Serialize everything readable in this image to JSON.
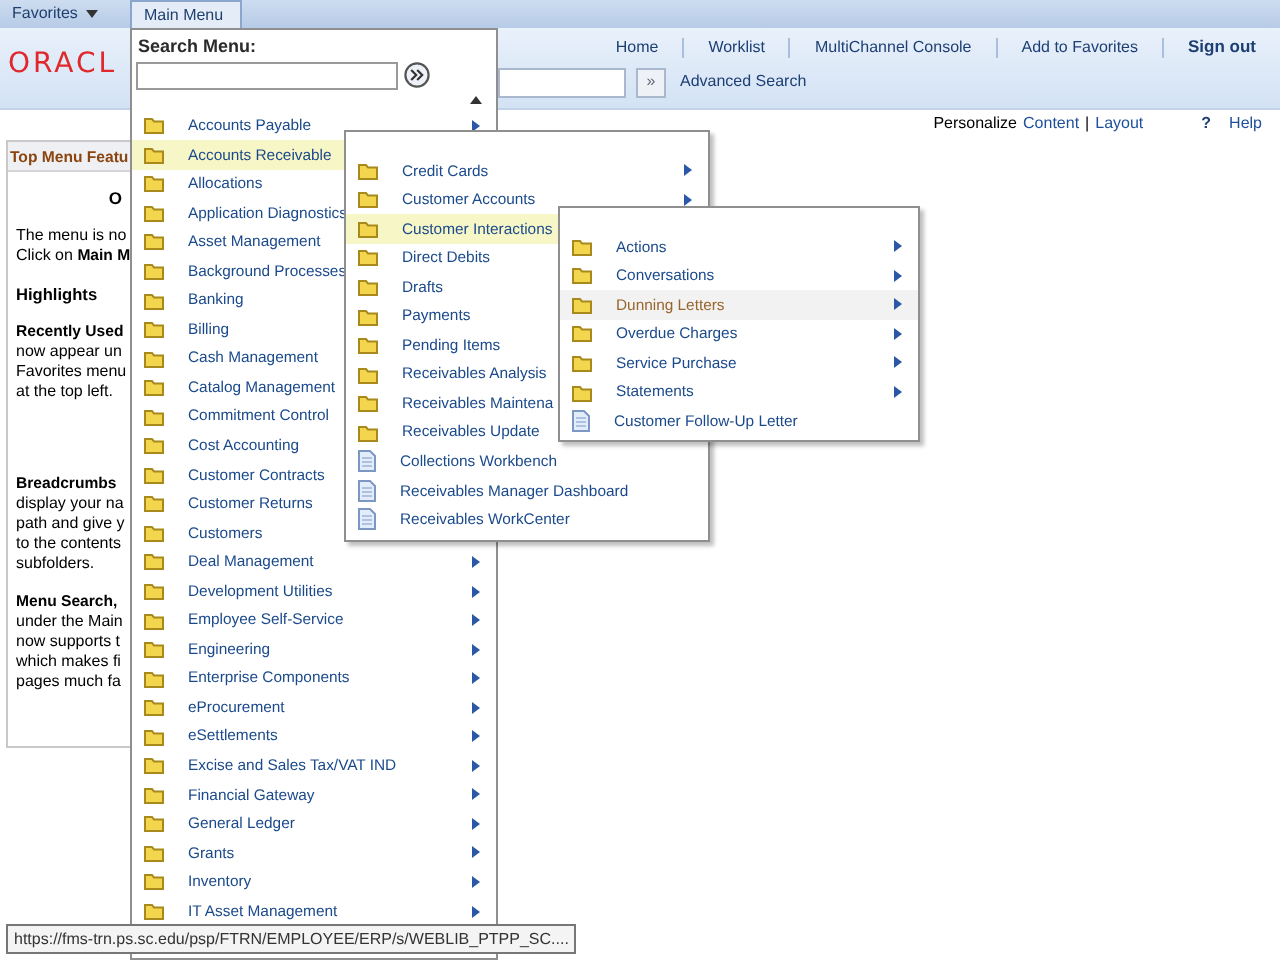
{
  "top_nav": [
    {
      "label": "Favorites",
      "selected": false
    },
    {
      "label": "Main Menu",
      "selected": true
    }
  ],
  "logo": "ORACL",
  "global_links": [
    {
      "label": "Home",
      "bold": false
    },
    {
      "label": "Worklist",
      "bold": false
    },
    {
      "label": "MultiChannel Console",
      "bold": false
    },
    {
      "label": "Add to Favorites",
      "bold": false
    },
    {
      "label": "Sign out",
      "bold": true
    }
  ],
  "search": {
    "button": "»",
    "link": "Advanced Search"
  },
  "personalize": {
    "label": "Personalize",
    "links": [
      "Content",
      "Layout"
    ],
    "separator": "|"
  },
  "help": {
    "icon": "?",
    "label": "Help"
  },
  "pagelet": {
    "title": "Top Menu Featu",
    "paragraphs": [
      {
        "lines": [
          "O"
        ],
        "kind": "center"
      },
      {
        "lines": [
          "The menu is no",
          "Click on **Main M**"
        ],
        "kind": "text"
      },
      {
        "lines": [
          "Highlights"
        ],
        "kind": "heading"
      },
      {
        "lines": [
          "**Recently Used**",
          "now appear un",
          "Favorites menu",
          "at the top left."
        ],
        "kind": "text"
      },
      {
        "lines": [
          "**Breadcrumbs**",
          "display your na",
          "path and give y",
          "to the contents",
          "subfolders."
        ],
        "kind": "text"
      },
      {
        "lines": [
          "**Menu Search,**",
          "under the Main",
          "now supports t",
          "which makes fi",
          "pages much fa"
        ],
        "kind": "text"
      }
    ]
  },
  "main_menu": {
    "search_label": "Search Menu:",
    "items": [
      {
        "label": "Accounts Payable",
        "kind": "folder",
        "selected": false,
        "arrow": true
      },
      {
        "label": "Accounts Receivable",
        "kind": "folder",
        "selected": true,
        "arrow": false
      },
      {
        "label": "Allocations",
        "kind": "folder",
        "selected": false,
        "arrow": false
      },
      {
        "label": "Application Diagnostics",
        "kind": "folder",
        "selected": false,
        "arrow": false
      },
      {
        "label": "Asset Management",
        "kind": "folder",
        "selected": false,
        "arrow": false
      },
      {
        "label": "Background Processes",
        "kind": "folder",
        "selected": false,
        "arrow": false
      },
      {
        "label": "Banking",
        "kind": "folder",
        "selected": false,
        "arrow": false
      },
      {
        "label": "Billing",
        "kind": "folder",
        "selected": false,
        "arrow": false
      },
      {
        "label": "Cash Management",
        "kind": "folder",
        "selected": false,
        "arrow": false
      },
      {
        "label": "Catalog Management",
        "kind": "folder",
        "selected": false,
        "arrow": false
      },
      {
        "label": "Commitment Control",
        "kind": "folder",
        "selected": false,
        "arrow": false
      },
      {
        "label": "Cost Accounting",
        "kind": "folder",
        "selected": false,
        "arrow": false
      },
      {
        "label": "Customer Contracts",
        "kind": "folder",
        "selected": false,
        "arrow": false
      },
      {
        "label": "Customer Returns",
        "kind": "folder",
        "selected": false,
        "arrow": false
      },
      {
        "label": "Customers",
        "kind": "folder",
        "selected": false,
        "arrow": false
      },
      {
        "label": "Deal Management",
        "kind": "folder",
        "selected": false,
        "arrow": true
      },
      {
        "label": "Development Utilities",
        "kind": "folder",
        "selected": false,
        "arrow": true
      },
      {
        "label": "Employee Self-Service",
        "kind": "folder",
        "selected": false,
        "arrow": true
      },
      {
        "label": "Engineering",
        "kind": "folder",
        "selected": false,
        "arrow": true
      },
      {
        "label": "Enterprise Components",
        "kind": "folder",
        "selected": false,
        "arrow": true
      },
      {
        "label": "eProcurement",
        "kind": "folder",
        "selected": false,
        "arrow": true
      },
      {
        "label": "eSettlements",
        "kind": "folder",
        "selected": false,
        "arrow": true
      },
      {
        "label": "Excise and Sales Tax/VAT IND",
        "kind": "folder",
        "selected": false,
        "arrow": true
      },
      {
        "label": "Financial Gateway",
        "kind": "folder",
        "selected": false,
        "arrow": true
      },
      {
        "label": "General Ledger",
        "kind": "folder",
        "selected": false,
        "arrow": true
      },
      {
        "label": "Grants",
        "kind": "folder",
        "selected": false,
        "arrow": true
      },
      {
        "label": "Inventory",
        "kind": "folder",
        "selected": false,
        "arrow": true
      },
      {
        "label": "IT Asset Management",
        "kind": "folder",
        "selected": false,
        "arrow": true
      }
    ]
  },
  "submenus": [
    {
      "items": [
        {
          "label": "Credit Cards",
          "kind": "folder",
          "selected": false,
          "hovered": false,
          "arrow": true
        },
        {
          "label": "Customer Accounts",
          "kind": "folder",
          "selected": false,
          "hovered": false,
          "arrow": true
        },
        {
          "label": "Customer Interactions",
          "kind": "folder",
          "selected": true,
          "hovered": false,
          "arrow": false
        },
        {
          "label": "Direct Debits",
          "kind": "folder",
          "selected": false,
          "hovered": false,
          "arrow": false
        },
        {
          "label": "Drafts",
          "kind": "folder",
          "selected": false,
          "hovered": false,
          "arrow": false
        },
        {
          "label": "Payments",
          "kind": "folder",
          "selected": false,
          "hovered": false,
          "arrow": false
        },
        {
          "label": "Pending Items",
          "kind": "folder",
          "selected": false,
          "hovered": false,
          "arrow": false
        },
        {
          "label": "Receivables Analysis",
          "kind": "folder",
          "selected": false,
          "hovered": false,
          "arrow": false
        },
        {
          "label": "Receivables Maintena",
          "kind": "folder",
          "selected": false,
          "hovered": false,
          "arrow": false
        },
        {
          "label": "Receivables Update",
          "kind": "folder",
          "selected": false,
          "hovered": false,
          "arrow": false
        },
        {
          "label": "Collections Workbench",
          "kind": "document",
          "selected": false,
          "hovered": false,
          "arrow": false
        },
        {
          "label": "Receivables Manager Dashboard",
          "kind": "document",
          "selected": false,
          "hovered": false,
          "arrow": false
        },
        {
          "label": "Receivables WorkCenter",
          "kind": "document",
          "selected": false,
          "hovered": false,
          "arrow": false
        }
      ]
    },
    {
      "items": [
        {
          "label": "Actions",
          "kind": "folder",
          "selected": false,
          "hovered": false,
          "arrow": true
        },
        {
          "label": "Conversations",
          "kind": "folder",
          "selected": false,
          "hovered": false,
          "arrow": true
        },
        {
          "label": "Dunning Letters",
          "kind": "folder",
          "selected": false,
          "hovered": true,
          "arrow": true
        },
        {
          "label": "Overdue Charges",
          "kind": "folder",
          "selected": false,
          "hovered": false,
          "arrow": true
        },
        {
          "label": "Service Purchase",
          "kind": "folder",
          "selected": false,
          "hovered": false,
          "arrow": true
        },
        {
          "label": "Statements",
          "kind": "folder",
          "selected": false,
          "hovered": false,
          "arrow": true
        },
        {
          "label": "Customer Follow-Up Letter",
          "kind": "document",
          "selected": false,
          "hovered": false,
          "arrow": false
        }
      ]
    }
  ],
  "status_url": "https://fms-trn.ps.sc.edu/psp/FTRN/EMPLOYEE/ERP/s/WEBLIB_PTPP_SC...."
}
